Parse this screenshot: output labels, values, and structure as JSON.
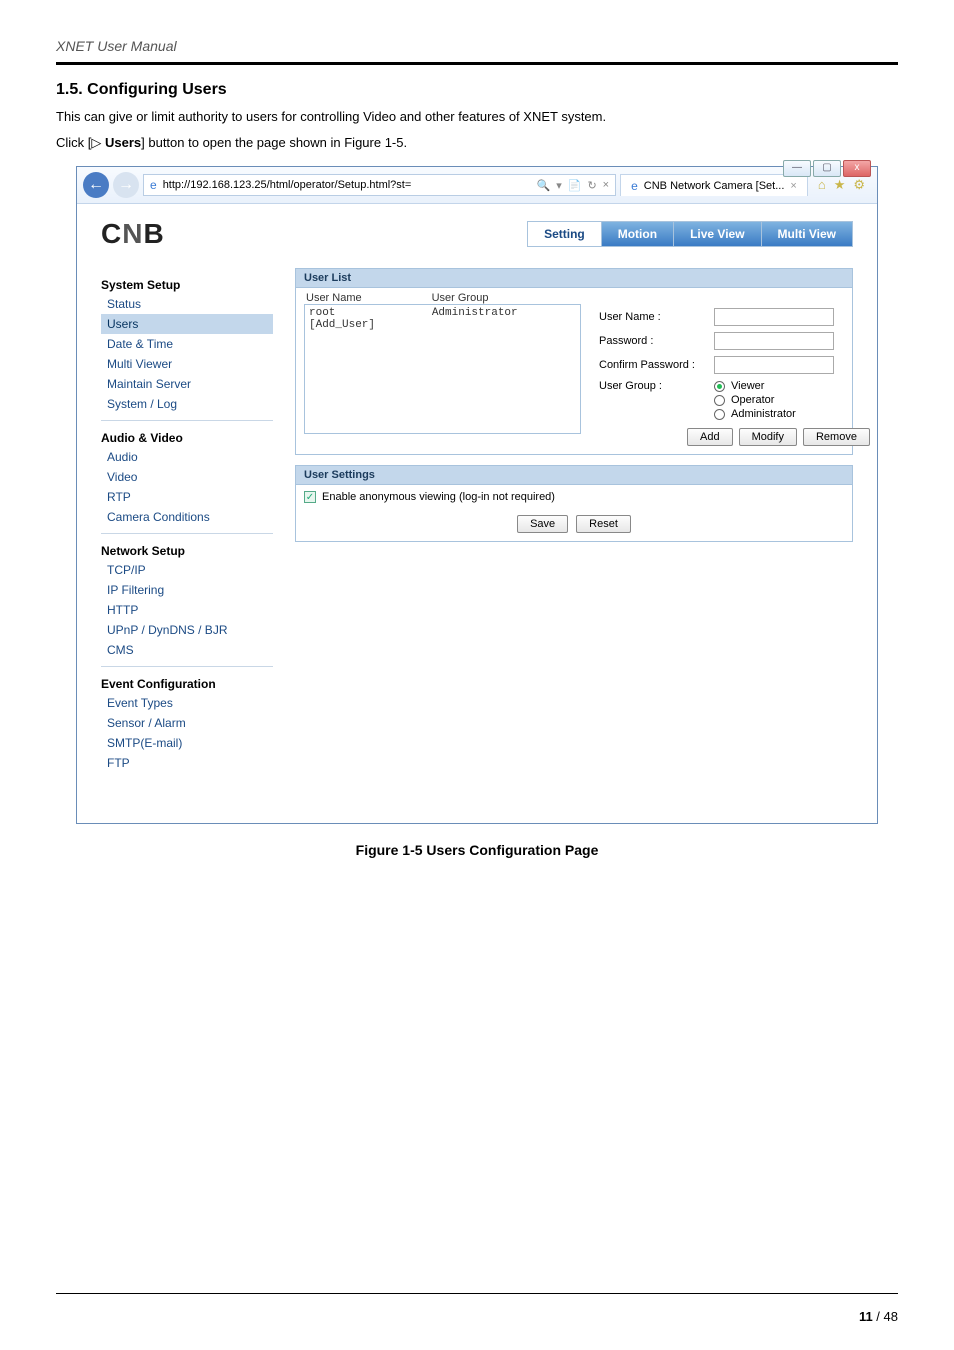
{
  "doc": {
    "title": "XNET User Manual",
    "section_heading": "1.5. Configuring Users",
    "intro_text": "This can give or limit authority to users for controlling Video and other features of XNET system.",
    "click_prefix": "Click [",
    "tri": "▷",
    "click_bold": " Users",
    "click_suffix": "] button to open the page shown in Figure 1-5.",
    "figure_caption": "Figure 1-5 Users Configuration Page",
    "page_current": "11",
    "page_sep": " / ",
    "page_total": "48"
  },
  "window": {
    "min": "—",
    "max": "▢",
    "close": "x"
  },
  "browser": {
    "url": "http://192.168.123.25/html/operator/Setup.html?st=",
    "search_glyph": "🔍",
    "dropdown_glyph": "▾",
    "cert_glyph": "📄",
    "refresh_glyph": "↻",
    "stop_glyph": "×",
    "tab_title": "CNB Network Camera [Set...",
    "tab_close": "×",
    "home_glyph": "⌂",
    "star_glyph": "★",
    "gear_glyph": "⚙"
  },
  "logo": {
    "c": "C",
    "n": "N",
    "b": "B"
  },
  "tabs": {
    "setting": "Setting",
    "motion": "Motion",
    "liveview": "Live View",
    "multiview": "Multi View"
  },
  "sidebar": {
    "system": {
      "head": "System Setup",
      "items": [
        "Status",
        "Users",
        "Date & Time",
        "Multi Viewer",
        "Maintain Server",
        "System / Log"
      ]
    },
    "av": {
      "head": "Audio & Video",
      "items": [
        "Audio",
        "Video",
        "RTP",
        "Camera Conditions"
      ]
    },
    "net": {
      "head": "Network Setup",
      "items": [
        "TCP/IP",
        "IP Filtering",
        "HTTP",
        "UPnP / DynDNS / BJR",
        "CMS"
      ]
    },
    "evt": {
      "head": "Event Configuration",
      "items": [
        "Event Types",
        "Sensor / Alarm",
        "SMTP(E-mail)",
        "FTP"
      ]
    }
  },
  "panel": {
    "userlist_title": "User List",
    "col_user": "User Name",
    "col_group": "User Group",
    "rows": [
      {
        "name": "root",
        "group": "Administrator"
      },
      {
        "name": "[Add_User]",
        "group": ""
      }
    ],
    "lbl_username": "User Name :",
    "lbl_password": "Password :",
    "lbl_confirm": "Confirm Password :",
    "lbl_group": "User Group :",
    "opt_viewer": "Viewer",
    "opt_operator": "Operator",
    "opt_admin": "Administrator",
    "btn_add": "Add",
    "btn_modify": "Modify",
    "btn_remove": "Remove",
    "usersettings_title": "User Settings",
    "cbx_label": "Enable anonymous viewing (log-in not required)",
    "btn_save": "Save",
    "btn_reset": "Reset",
    "checkmark": "✓"
  }
}
